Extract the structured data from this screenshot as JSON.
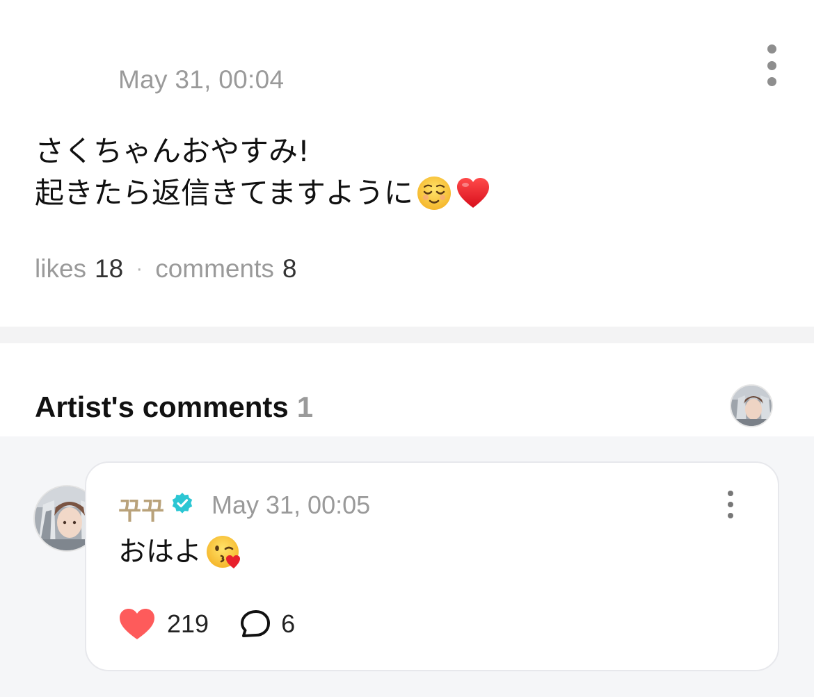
{
  "post": {
    "date": "May 31, 00:04",
    "text_line1": "さくちゃんおやすみ!",
    "text_line2": "起きたら返信きてますように",
    "likes_label": "likes",
    "likes_count": "18",
    "separator": "·",
    "comments_label": "comments",
    "comments_count": "8"
  },
  "artist_section": {
    "title": "Artist's comments",
    "count": "1"
  },
  "comment": {
    "author": "꾸꾸",
    "date": "May 31, 00:05",
    "text": "おはよ",
    "like_count": "219",
    "reply_count": "6"
  },
  "colors": {
    "heart": "#fe5b5b",
    "verified": "#2bc6d3",
    "author_name": "#b9a27a",
    "muted_text": "#9a9a9a"
  },
  "icons": {
    "post_menu": "more-vertical-icon",
    "comment_menu": "more-vertical-icon",
    "verified": "verified-badge-icon",
    "like": "heart-icon",
    "reply": "speech-bubble-icon",
    "emoji1": "relieved-face-emoji",
    "emoji2": "red-heart-emoji",
    "emoji3": "face-blowing-kiss-emoji"
  }
}
